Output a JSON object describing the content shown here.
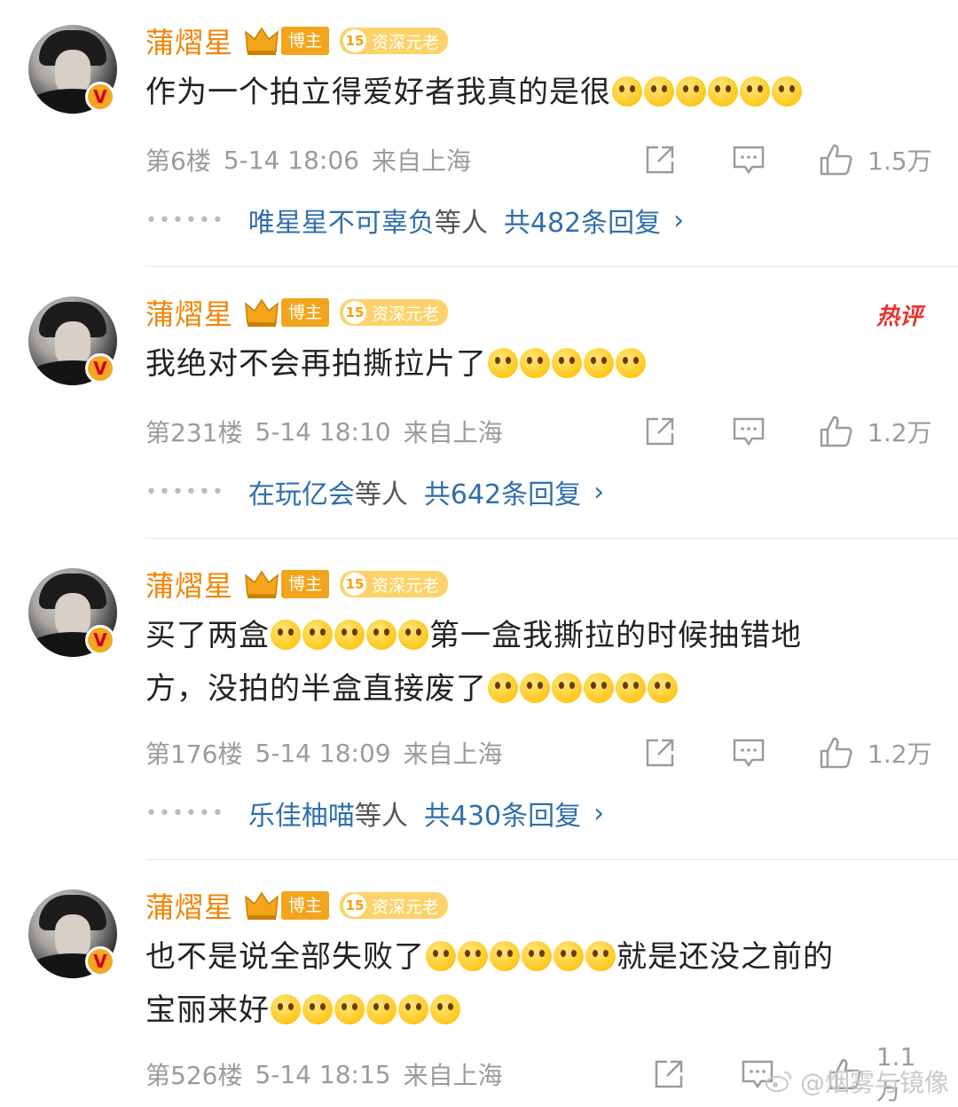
{
  "comments": [
    {
      "user": "蒲熠星",
      "badge_blogger": "博主",
      "badge_vet_num": "15",
      "badge_vet_label": "资深元老",
      "hot": "",
      "line1_pre": "作为一个拍立得爱好者我真的是很",
      "line1_emoji": 6,
      "floor": "第6楼",
      "time": "5-14 18:06",
      "location": "来自上海",
      "likes": "1.5万",
      "reply_users": "唯星星不可辜负",
      "reply_etc": "等人",
      "reply_count": "共482条回复"
    },
    {
      "user": "蒲熠星",
      "badge_blogger": "博主",
      "badge_vet_num": "15",
      "badge_vet_label": "资深元老",
      "hot": "热评",
      "line1_pre": "我绝对不会再拍撕拉片了",
      "floor": "第231楼",
      "time": "5-14 18:10",
      "location": "来自上海",
      "likes": "1.2万",
      "reply_users": "在玩亿会",
      "reply_etc": "等人",
      "reply_count": "共642条回复"
    },
    {
      "user": "蒲熠星",
      "badge_blogger": "博主",
      "badge_vet_num": "15",
      "badge_vet_label": "资深元老",
      "line1_pre": "买了两盒",
      "line1_post": "第一盒我撕拉的时候抽错地",
      "line2_pre": "方，没拍的半盒直接废了",
      "floor": "第176楼",
      "time": "5-14 18:09",
      "location": "来自上海",
      "likes": "1.2万",
      "reply_users": "乐佳柚喵",
      "reply_etc": "等人",
      "reply_count": "共430条回复"
    },
    {
      "user": "蒲熠星",
      "badge_blogger": "博主",
      "badge_vet_num": "15",
      "badge_vet_label": "资深元老",
      "line1_pre": "也不是说全部失败了",
      "line1_post": "就是还没之前的",
      "line2_pre": "宝丽来好",
      "floor": "第526楼",
      "time": "5-14 18:15",
      "location": "来自上海",
      "likes": "1.1万"
    }
  ],
  "watermark": "@烟雾与镜像",
  "colors": {
    "username": "#f08300",
    "link": "#2f6faa",
    "meta": "#9b9b9b",
    "hot": "#e8352e"
  },
  "icons": [
    "verified-v-icon",
    "crown-icon",
    "share-icon",
    "comment-icon",
    "like-icon",
    "chevron-right-icon",
    "weibo-logo-icon"
  ]
}
